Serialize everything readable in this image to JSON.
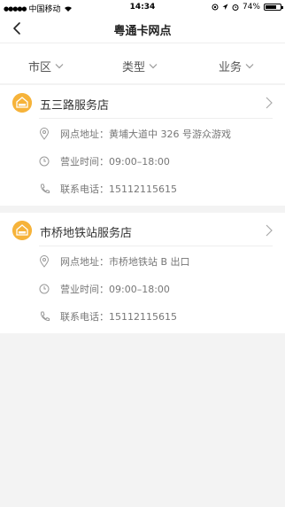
{
  "status_bar": {
    "carrier": "中国移动",
    "time": "14:34",
    "battery": "74%",
    "battery_level": 0.74
  },
  "nav": {
    "title": "粤通卡网点"
  },
  "filters": [
    {
      "label": "市区"
    },
    {
      "label": "类型"
    },
    {
      "label": "业务"
    }
  ],
  "stores": [
    {
      "name": "五三路服务店",
      "address_label": "网点地址：",
      "address": "黄埔大道中 326 号游众游戏",
      "hours_label": "营业时间：",
      "hours": "09:00–18:00",
      "phone_label": "联系电话：",
      "phone": "15112115615"
    },
    {
      "name": "市桥地铁站服务店",
      "address_label": "网点地址：",
      "address": "市桥地铁站 B 出口",
      "hours_label": "营业时间：",
      "hours": "09:00–18:00",
      "phone_label": "联系电话：",
      "phone": "15112115615"
    }
  ],
  "colors": {
    "accent": "#f6b33a",
    "background": "#f3f3f3"
  }
}
